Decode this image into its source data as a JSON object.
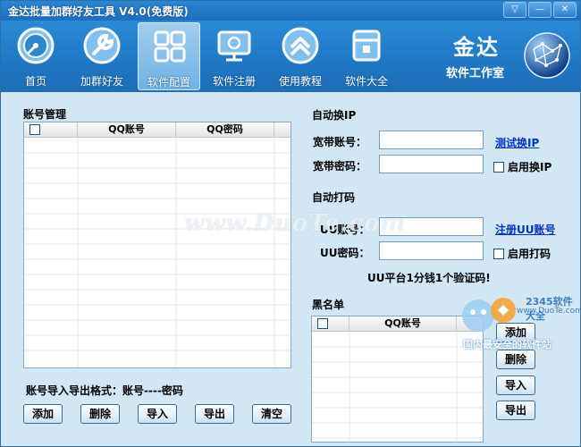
{
  "window": {
    "title": "金达批量加群好友工具 V4.0(免费版)",
    "btn_menu": "▽",
    "btn_minimize": "—",
    "btn_close": "✕"
  },
  "toolbar": {
    "items": [
      {
        "label": "首页",
        "icon": "dashboard-gauge-icon"
      },
      {
        "label": "加群好友",
        "icon": "wrench-icon"
      },
      {
        "label": "软件配置",
        "icon": "grid-icon"
      },
      {
        "label": "软件注册",
        "icon": "monitor-register-icon"
      },
      {
        "label": "使用教程",
        "icon": "chevron-up-badge-icon"
      },
      {
        "label": "软件大全",
        "icon": "box-icon"
      }
    ],
    "active_index": 2
  },
  "brand": {
    "name": "金达",
    "subtitle": "软件工作室"
  },
  "account": {
    "section_label": "账号管理",
    "columns": [
      "QQ账号",
      "QQ密码"
    ],
    "format_hint": "账号导入导出格式：账号----密码",
    "buttons": {
      "add": "添加",
      "delete": "删除",
      "import": "导入",
      "export": "导出",
      "clear": "清空"
    }
  },
  "auto_ip": {
    "section_label": "自动换IP",
    "broadband_account_label": "宽带账号：",
    "broadband_account_value": "",
    "broadband_password_label": "宽带密码：",
    "broadband_password_value": "",
    "test_link": "测试换IP",
    "enable_label": "启用换IP"
  },
  "auto_captcha": {
    "section_label": "自动打码",
    "uu_account_label": "UU账号：",
    "uu_account_value": "",
    "uu_password_label": "UU密码：",
    "uu_password_value": "",
    "register_link": "注册UU账号",
    "enable_label": "启用打码",
    "note": "UU平台1分钱1个验证码!"
  },
  "blacklist": {
    "section_label": "黑名单",
    "columns": [
      "QQ账号"
    ],
    "buttons": {
      "add": "添加",
      "delete": "删除",
      "import": "导入",
      "export": "导出"
    }
  },
  "overlay": {
    "watermark": "www.DuoTe.com",
    "corner_line1": "2345软件大全",
    "corner_line2": "www.DuoTe.com",
    "corner_line3": "国内最安全的软件站"
  }
}
